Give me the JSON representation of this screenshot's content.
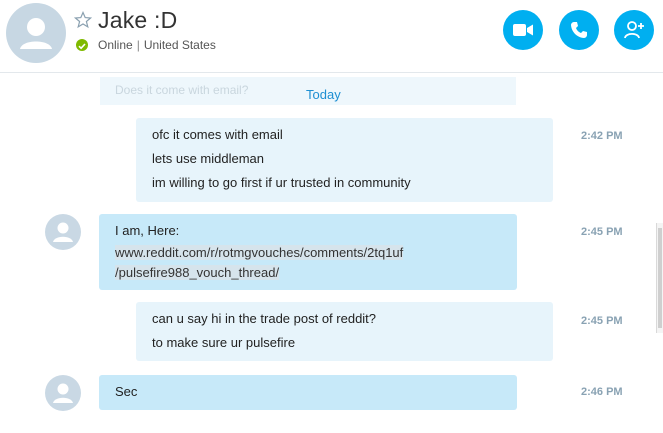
{
  "contact": {
    "name": "Jake :D",
    "status": "Online",
    "location": "United States"
  },
  "colors": {
    "accent": "#00aff0",
    "online": "#7fba00",
    "bubble_incoming": "#c7e9f9",
    "bubble_outgoing": "#e7f4fb",
    "day_label": "#1e8fd2"
  },
  "header_actions": [
    {
      "name": "video-call-button",
      "icon": "video-camera-icon"
    },
    {
      "name": "voice-call-button",
      "icon": "phone-icon"
    },
    {
      "name": "add-people-button",
      "icon": "add-person-icon"
    }
  ],
  "chat": {
    "faded_previous": "Does it come with email?",
    "day_label": "Today",
    "messages": [
      {
        "direction": "out",
        "lines": [
          "ofc it comes with email",
          "lets use middleman",
          "im willing to go first if ur trusted in community"
        ],
        "time": "2:42 PM"
      },
      {
        "direction": "in",
        "lines": [
          "I am, Here:",
          "www.reddit.com/r/rotmgvouches/comments/2tq1uf",
          "/pulsefire988_vouch_thread/"
        ],
        "time": "2:45 PM"
      },
      {
        "direction": "out",
        "lines": [
          "can u say hi in the trade post of reddit?",
          "to make sure ur pulsefire"
        ],
        "time": "2:45 PM"
      },
      {
        "direction": "in",
        "lines": [
          "Sec"
        ],
        "time": "2:46 PM"
      }
    ]
  }
}
